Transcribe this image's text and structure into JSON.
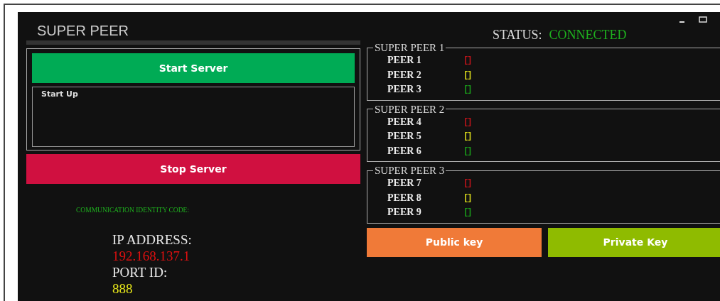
{
  "title": "SUPER PEER",
  "status": {
    "label": "STATUS:",
    "value": "CONNECTED"
  },
  "start_button": "Start Server",
  "log": {
    "label": "Start Up"
  },
  "stop_button": "Stop Server",
  "identity": {
    "heading": "COMMUNICATION IDENTITY CODE:",
    "ip_label": "IP ADDRESS:",
    "ip": "192.168.137.1",
    "port_label": "PORT ID:",
    "port": "888"
  },
  "super_peers": [
    {
      "title": "SUPER PEER 1",
      "peers": [
        {
          "name": "PEER 1",
          "mark": "[]",
          "color": "#c0141a"
        },
        {
          "name": "PEER 2",
          "mark": "[]",
          "color": "#d6d61a"
        },
        {
          "name": "PEER 3",
          "mark": "[]",
          "color": "#1a9a1a"
        }
      ]
    },
    {
      "title": "SUPER PEER 2",
      "peers": [
        {
          "name": "PEER 4",
          "mark": "[]",
          "color": "#c0141a"
        },
        {
          "name": "PEER 5",
          "mark": "[]",
          "color": "#d6d61a"
        },
        {
          "name": "PEER 6",
          "mark": "[]",
          "color": "#1a9a1a"
        }
      ]
    },
    {
      "title": "SUPER PEER 3",
      "peers": [
        {
          "name": "PEER 7",
          "mark": "[]",
          "color": "#c0141a"
        },
        {
          "name": "PEER 8",
          "mark": "[]",
          "color": "#d6d61a"
        },
        {
          "name": "PEER 9",
          "mark": "[]",
          "color": "#1a9a1a"
        }
      ]
    }
  ],
  "public_key_button": "Public key",
  "private_key_button": "Private Key"
}
